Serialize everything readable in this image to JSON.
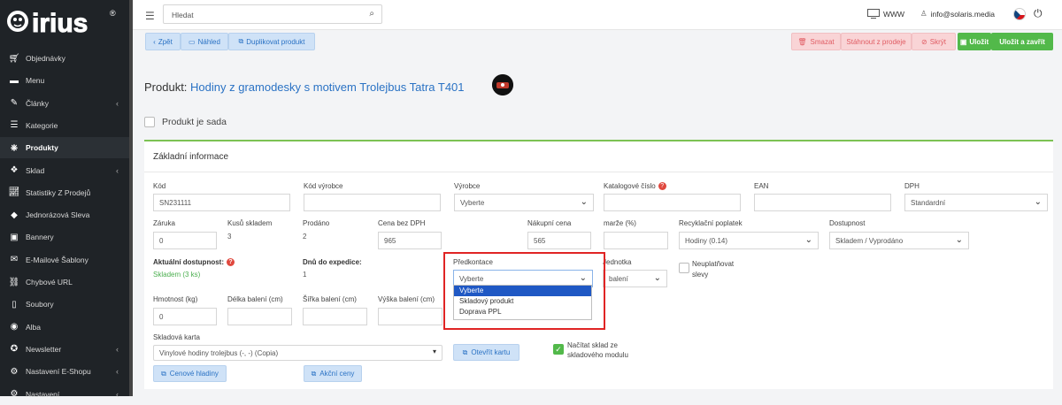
{
  "logo": {
    "text": "irius",
    "mark": "®"
  },
  "sidebar": {
    "items": [
      {
        "label": "Objednávky",
        "icon": "cart-icon",
        "chevron": false,
        "active": false
      },
      {
        "label": "Menu",
        "icon": "folder-icon",
        "chevron": false,
        "active": false
      },
      {
        "label": "Články",
        "icon": "pencil-icon",
        "chevron": true,
        "active": false
      },
      {
        "label": "Kategorie",
        "icon": "list-icon",
        "chevron": false,
        "active": false
      },
      {
        "label": "Produkty",
        "icon": "dharma-icon",
        "chevron": false,
        "active": true
      },
      {
        "label": "Sklad",
        "icon": "dropbox-icon",
        "chevron": true,
        "active": false
      },
      {
        "label": "Statistiky Z Prodejů",
        "icon": "chart-icon",
        "chevron": false,
        "active": false
      },
      {
        "label": "Jednorázová Sleva",
        "icon": "tag-icon",
        "chevron": false,
        "active": false
      },
      {
        "label": "Bannery",
        "icon": "image-icon",
        "chevron": false,
        "active": false
      },
      {
        "label": "E-Mailové Šablony",
        "icon": "envelope-icon",
        "chevron": false,
        "active": false
      },
      {
        "label": "Chybové URL",
        "icon": "link-icon",
        "chevron": false,
        "active": false
      },
      {
        "label": "Soubory",
        "icon": "file-icon",
        "chevron": false,
        "active": false
      },
      {
        "label": "Alba",
        "icon": "camera-icon",
        "chevron": false,
        "active": false
      },
      {
        "label": "Newsletter",
        "icon": "settings-circle-icon",
        "chevron": true,
        "active": false
      },
      {
        "label": "Nastavení E-Shopu",
        "icon": "cogs-icon",
        "chevron": true,
        "active": false
      },
      {
        "label": "Nastavení",
        "icon": "cogs-icon",
        "chevron": true,
        "active": false
      }
    ]
  },
  "topbar": {
    "search_placeholder": "Hledat",
    "www_label": "WWW",
    "email": "info@solaris.media"
  },
  "toolbar": {
    "back": "Zpět",
    "preview": "Náhled",
    "duplicate": "Duplikovat produkt",
    "delete": "Smazat",
    "withdraw": "Stáhnout z prodeje",
    "hide": "Skrýt",
    "save": "Uložit",
    "save_close": "Uložit a zavřít"
  },
  "product": {
    "prefix": "Produkt: ",
    "name": "Hodiny z gramodesky s motivem Trolejbus Tatra T401",
    "set_label": "Produkt je sada"
  },
  "card": {
    "header": "Základní informace"
  },
  "form": {
    "kod_label": "Kód",
    "kod_value": "SN231111",
    "kod_vyrobce_label": "Kód výrobce",
    "vyrobce_label": "Výrobce",
    "vyrobce_value": "Vyberte",
    "katalog_label": "Katalogové číslo",
    "ean_label": "EAN",
    "dph_label": "DPH",
    "dph_value": "Standardní",
    "zaruka_label": "Záruka",
    "zaruka_value": "0",
    "kusu_label": "Kusů skladem",
    "kusu_value": "3",
    "prodano_label": "Prodáno",
    "prodano_value": "2",
    "cena_label": "Cena bez DPH",
    "cena_value": "965",
    "nakupni_label": "Nákupní cena",
    "nakupni_value": "565",
    "marze_label": "marže (%)",
    "recyk_label": "Recyklační poplatek",
    "recyk_value": "Hodiny (0.14)",
    "dostupnost_label": "Dostupnost",
    "dostupnost_value": "Skladem / Vyprodáno",
    "akt_dost_label": "Aktuální dostupnost:",
    "akt_dost_value": "Skladem (3 ks)",
    "dnu_label": "Dnů do expedice:",
    "dnu_value": "1",
    "predkontace_label": "Předkontace",
    "predkontace_value": "Vyberte",
    "jednotka_label": "Jednotka",
    "jednotka_value": "balení",
    "neuplat_label_1": "Neuplatňovat",
    "neuplat_label_2": "slevy",
    "hmotnost_label": "Hmotnost (kg)",
    "hmotnost_value": "0",
    "delka_label": "Délka balení (cm)",
    "sirka_label": "Šířka balení (cm)",
    "vyska_label": "Výška balení (cm)",
    "skladova_label": "Skladová karta",
    "skladova_value": "Vinylové hodiny trolejbus (-, -) (Copia)",
    "otevrit_label": "Otevřít kartu",
    "nacitat_label_1": "Načítat sklad ze",
    "nacitat_label_2": "skladového modulu",
    "cenove_label": "Cenové hladiny",
    "akcni_label": "Akční ceny"
  },
  "dropdown": {
    "options": [
      "Vyberte",
      "Skladový produkt",
      "Doprava PPL"
    ],
    "selected": "Vyberte"
  },
  "colors": {
    "accent_blue": "#2a72c4",
    "green": "#52b94a",
    "red": "#e05c63",
    "sidebar_bg": "#1f2327",
    "highlight": "#e02424"
  }
}
